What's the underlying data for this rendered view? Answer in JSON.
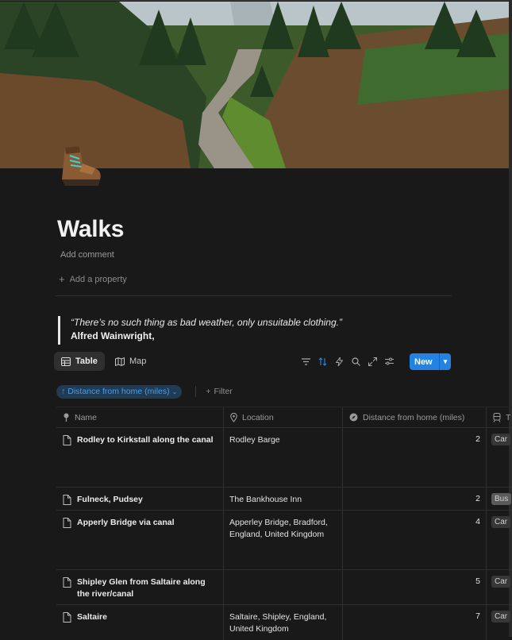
{
  "page": {
    "title": "Walks",
    "add_comment": "Add comment",
    "add_property": "Add a property",
    "icon": "hiking-boot-icon"
  },
  "quote": {
    "text": "“There’s no such thing as bad weather, only unsuitable clothing.”",
    "author": "Alfred Wainwright,"
  },
  "views": {
    "tabs": [
      {
        "label": "Table",
        "icon": "table-icon",
        "active": true
      },
      {
        "label": "Map",
        "icon": "map-icon",
        "active": false
      }
    ],
    "toolbar_icons": [
      "filter-icon",
      "sort-icon",
      "automation-icon",
      "search-icon",
      "expand-icon",
      "settings-icon"
    ],
    "new_label": "New"
  },
  "filters": {
    "sort_chip": "Distance from home (miles)",
    "add_filter": "Filter"
  },
  "table": {
    "columns": [
      {
        "label": "Name",
        "icon": "pin-icon"
      },
      {
        "label": "Location",
        "icon": "location-icon"
      },
      {
        "label": "Distance from home (miles)",
        "icon": "compass-icon"
      },
      {
        "label": "T",
        "icon": "train-icon"
      }
    ],
    "rows": [
      {
        "name": "Rodley to Kirkstall along the canal",
        "location": "Rodley Barge",
        "distance": "2",
        "tag": "Car"
      },
      {
        "name": "Fulneck, Pudsey",
        "location": "The Bankhouse Inn",
        "distance": "2",
        "tag": "Bus"
      },
      {
        "name": "Apperly Bridge via canal",
        "location": "Apperley Bridge, Bradford, England, United Kingdom",
        "distance": "4",
        "tag": "Car"
      },
      {
        "name": "Shipley Glen from Saltaire along the river/canal",
        "location": "",
        "distance": "5",
        "tag": "Car"
      },
      {
        "name": "Saltaire",
        "location": "Saltaire, Shipley, England, United Kingdom",
        "distance": "7",
        "tag": "Car"
      }
    ]
  },
  "colors": {
    "background": "#191919",
    "accent": "#2383e2",
    "chip_bg": "#1f3b56",
    "chip_text": "#4a9de8"
  }
}
